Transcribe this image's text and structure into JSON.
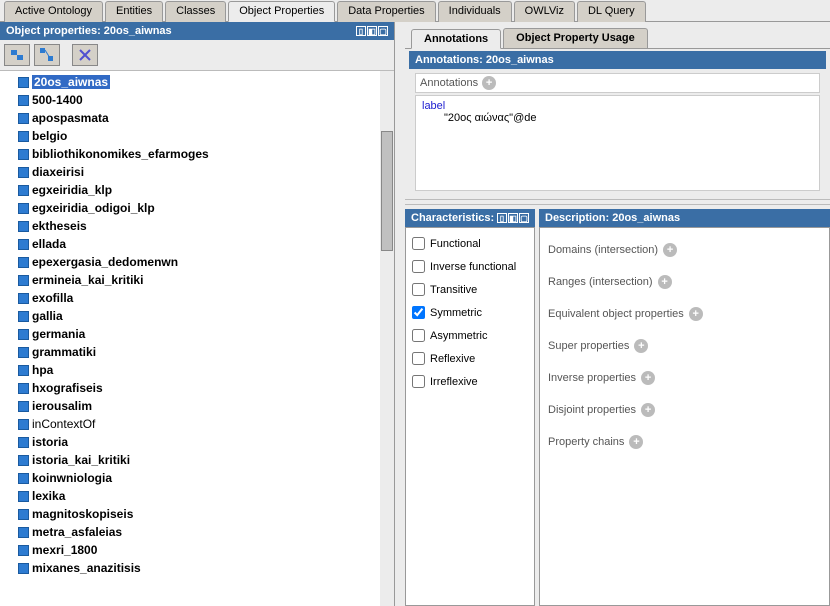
{
  "main_tabs": [
    "Active Ontology",
    "Entities",
    "Classes",
    "Object Properties",
    "Data Properties",
    "Individuals",
    "OWLViz",
    "DL Query"
  ],
  "main_tab_active_index": 3,
  "left_panel_title": "Object properties: 20os_aiwnas",
  "tree_items": [
    {
      "label": "20os_aiwnas",
      "selected": true
    },
    {
      "label": "500-1400"
    },
    {
      "label": "apospasmata"
    },
    {
      "label": "belgio"
    },
    {
      "label": "bibliothikonomikes_efarmoges"
    },
    {
      "label": "diaxeirisi"
    },
    {
      "label": "egxeiridia_klp"
    },
    {
      "label": "egxeiridia_odigoi_klp"
    },
    {
      "label": "ektheseis"
    },
    {
      "label": "ellada"
    },
    {
      "label": "epexergasia_dedomenwn"
    },
    {
      "label": "ermineia_kai_kritiki"
    },
    {
      "label": "exofilla"
    },
    {
      "label": "gallia"
    },
    {
      "label": "germania"
    },
    {
      "label": "grammatiki"
    },
    {
      "label": "hpa"
    },
    {
      "label": "hxografiseis"
    },
    {
      "label": "ierousalim"
    },
    {
      "label": "inContextOf",
      "style": "normal"
    },
    {
      "label": "istoria"
    },
    {
      "label": "istoria_kai_kritiki"
    },
    {
      "label": "koinwniologia"
    },
    {
      "label": "lexika"
    },
    {
      "label": "magnitoskopiseis"
    },
    {
      "label": "metra_asfaleias"
    },
    {
      "label": "mexri_1800"
    },
    {
      "label": "mixanes_anazitisis"
    }
  ],
  "subtabs": [
    "Annotations",
    "Object Property Usage"
  ],
  "subtab_active_index": 0,
  "annotations_title": "Annotations: 20os_aiwnas",
  "annotations_header_label": "Annotations",
  "annotation_entry": {
    "key": "label",
    "value": "\"20ος αιώνας\"@de"
  },
  "characteristics_title": "Characteristics:",
  "characteristics": [
    {
      "label": "Functional",
      "checked": false
    },
    {
      "label": "Inverse functional",
      "checked": false
    },
    {
      "label": "Transitive",
      "checked": false
    },
    {
      "label": "Symmetric",
      "checked": true
    },
    {
      "label": "Asymmetric",
      "checked": false
    },
    {
      "label": "Reflexive",
      "checked": false
    },
    {
      "label": "Irreflexive",
      "checked": false
    }
  ],
  "description_title": "Description: 20os_aiwnas",
  "description_sections": [
    "Domains (intersection)",
    "Ranges (intersection)",
    "Equivalent object properties",
    "Super properties",
    "Inverse properties",
    "Disjoint properties",
    "Property chains"
  ]
}
